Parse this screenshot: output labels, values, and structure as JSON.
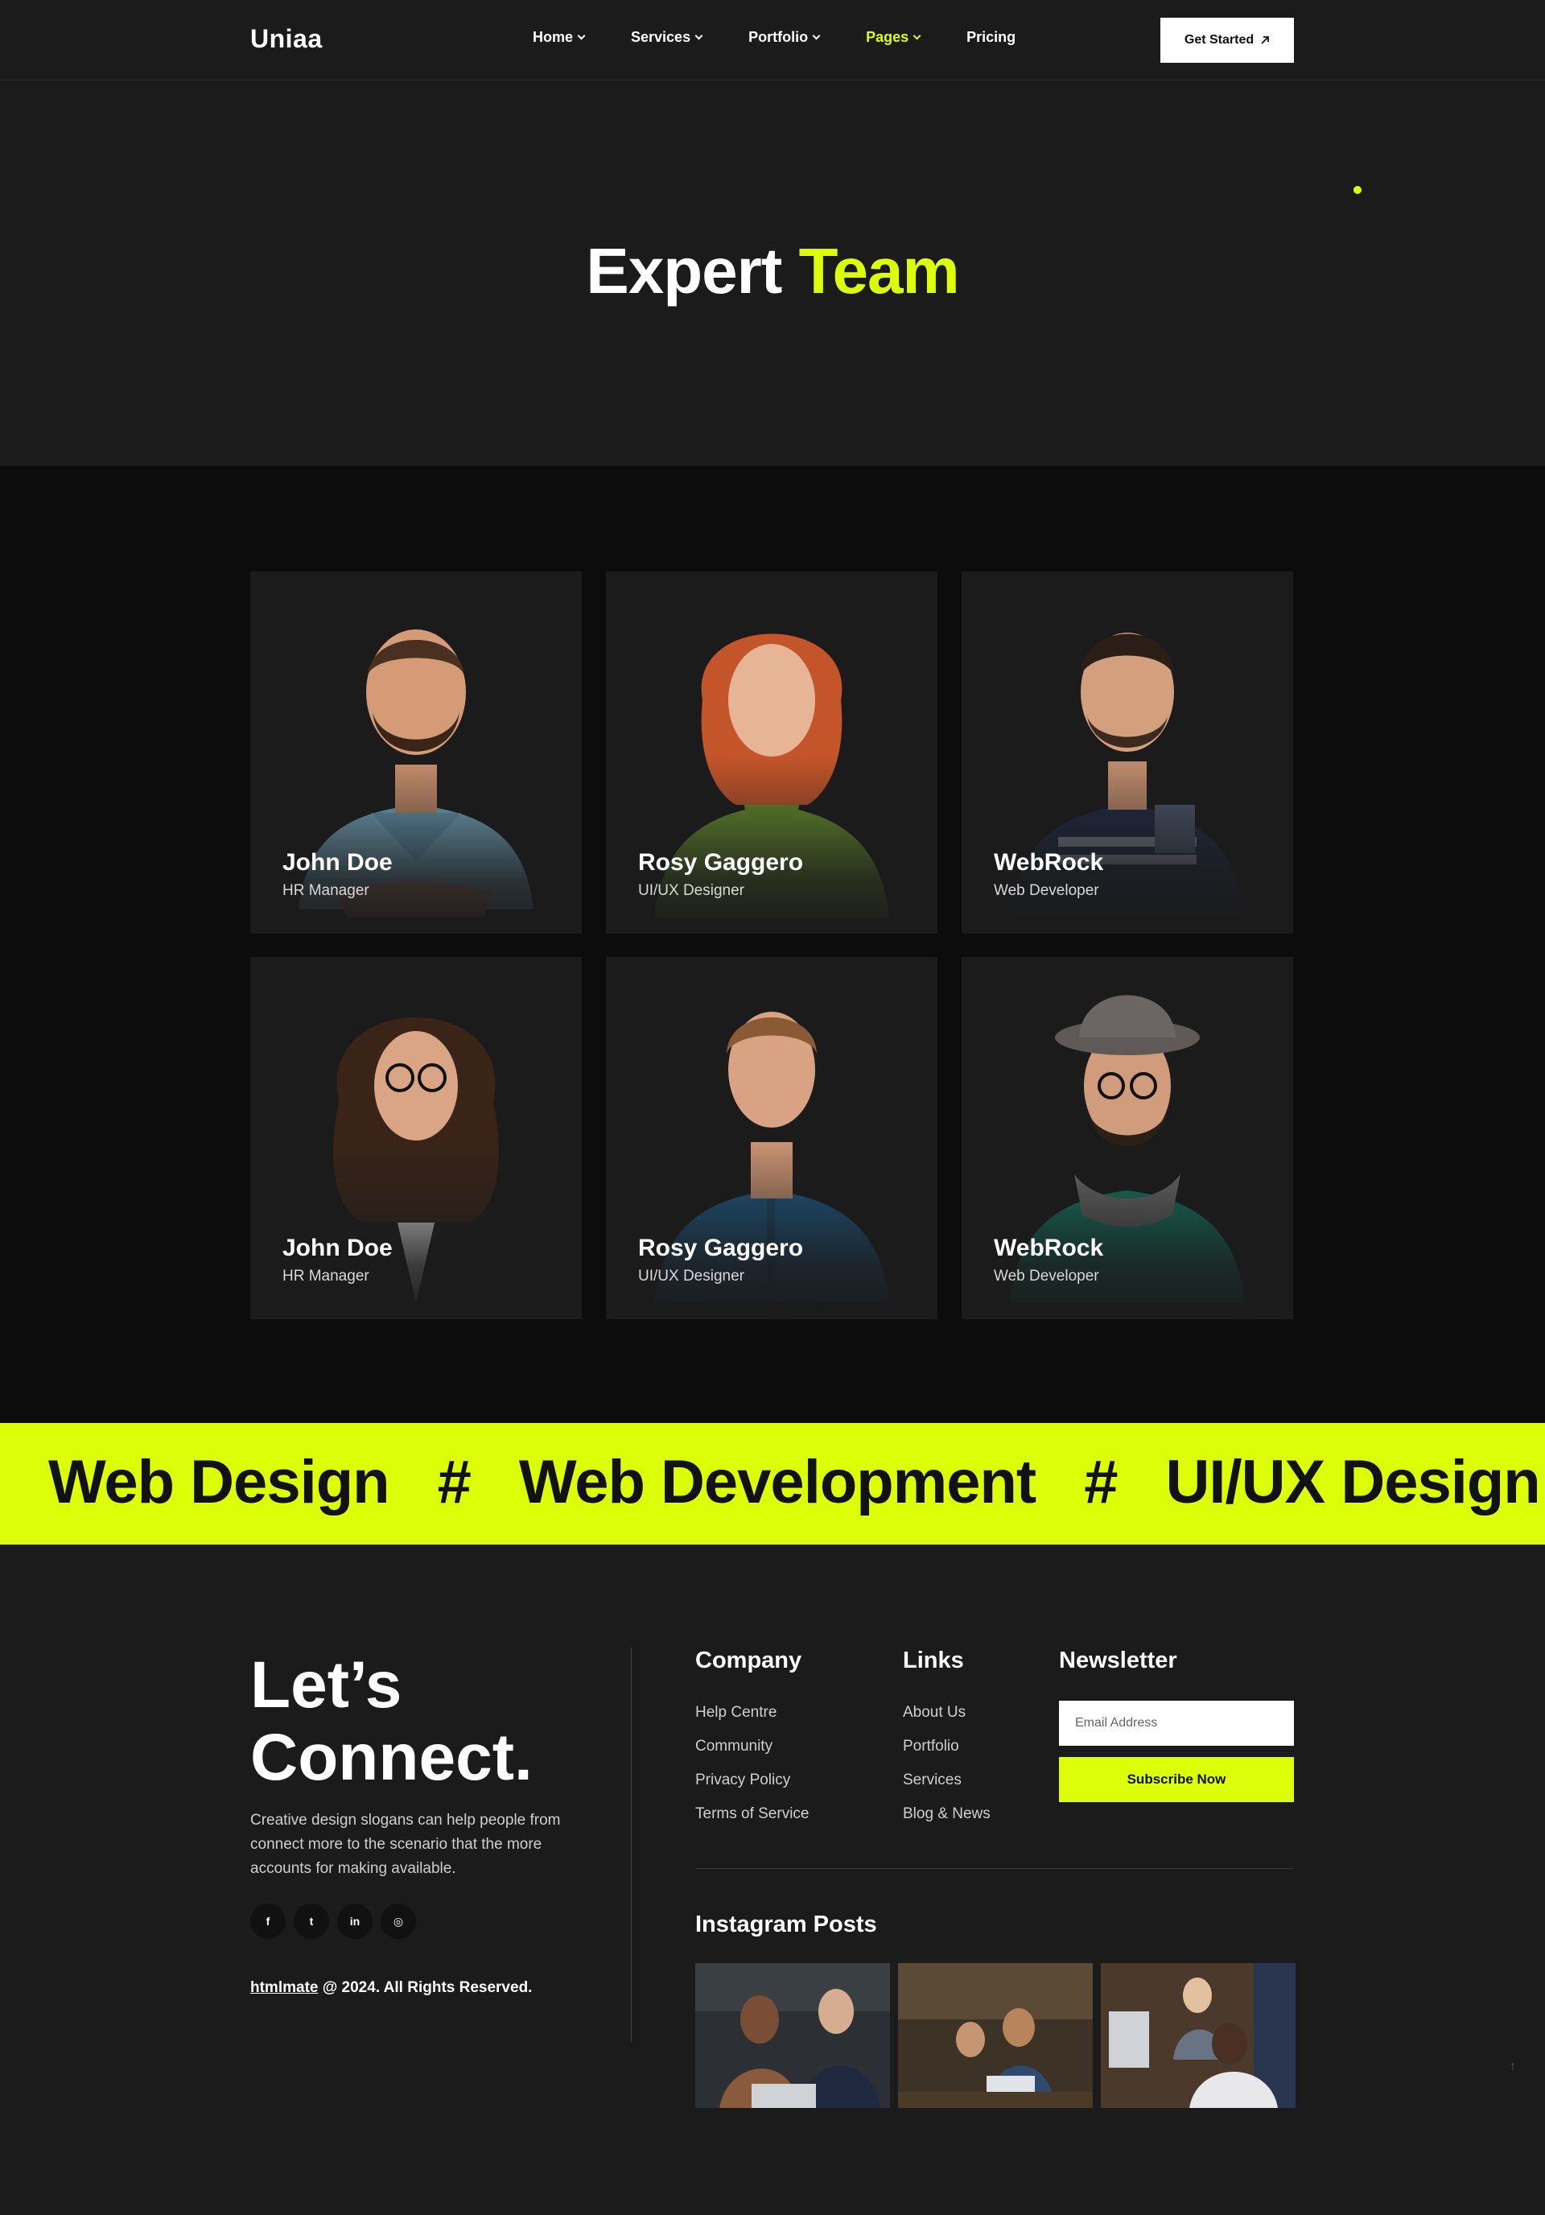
{
  "header": {
    "logo": "Uniaa",
    "nav": [
      {
        "label": "Home",
        "dropdown": true,
        "active": false
      },
      {
        "label": "Services",
        "dropdown": true,
        "active": false
      },
      {
        "label": "Portfolio",
        "dropdown": true,
        "active": false
      },
      {
        "label": "Pages",
        "dropdown": true,
        "active": true
      },
      {
        "label": "Pricing",
        "dropdown": false,
        "active": false
      }
    ],
    "cta_label": "Get Started"
  },
  "hero": {
    "title_main": "Expert",
    "title_accent": "Team"
  },
  "team": [
    {
      "name": "John Doe",
      "role": "HR Manager"
    },
    {
      "name": "Rosy Gaggero",
      "role": "UI/UX Designer"
    },
    {
      "name": "WebRock",
      "role": "Web Developer"
    },
    {
      "name": "John Doe",
      "role": "HR Manager"
    },
    {
      "name": "Rosy Gaggero",
      "role": "UI/UX Designer"
    },
    {
      "name": "WebRock",
      "role": "Web Developer"
    }
  ],
  "marquee": [
    "Web Design",
    "#",
    "Web Development",
    "#",
    "UI/UX Design"
  ],
  "footer": {
    "connect_title_1": "Let’s",
    "connect_title_2": "Connect.",
    "connect_text": "Creative design slogans can help people from connect more to the scenario that the more accounts for making available.",
    "socials": [
      {
        "icon": "facebook-icon",
        "glyph": "f"
      },
      {
        "icon": "twitter-icon",
        "glyph": "t"
      },
      {
        "icon": "linkedin-icon",
        "glyph": "in"
      },
      {
        "icon": "instagram-icon",
        "glyph": "◎"
      }
    ],
    "copyright_brand": "htmlmate",
    "copyright_text": " @ 2024. All Rights Reserved.",
    "company_title": "Company",
    "company_links": [
      "Help Centre",
      "Community",
      "Privacy Policy",
      "Terms of Service"
    ],
    "links_title": "Links",
    "links": [
      "About Us",
      "Portfolio",
      "Services",
      "Blog & News"
    ],
    "newsletter_title": "Newsletter",
    "email_placeholder": "Email Address",
    "subscribe_label": "Subscribe Now",
    "instagram_title": "Instagram Posts"
  },
  "colors": {
    "accent": "#dcfe08",
    "bg": "#1b1b1c",
    "bg_dark": "#0c0c0d"
  }
}
